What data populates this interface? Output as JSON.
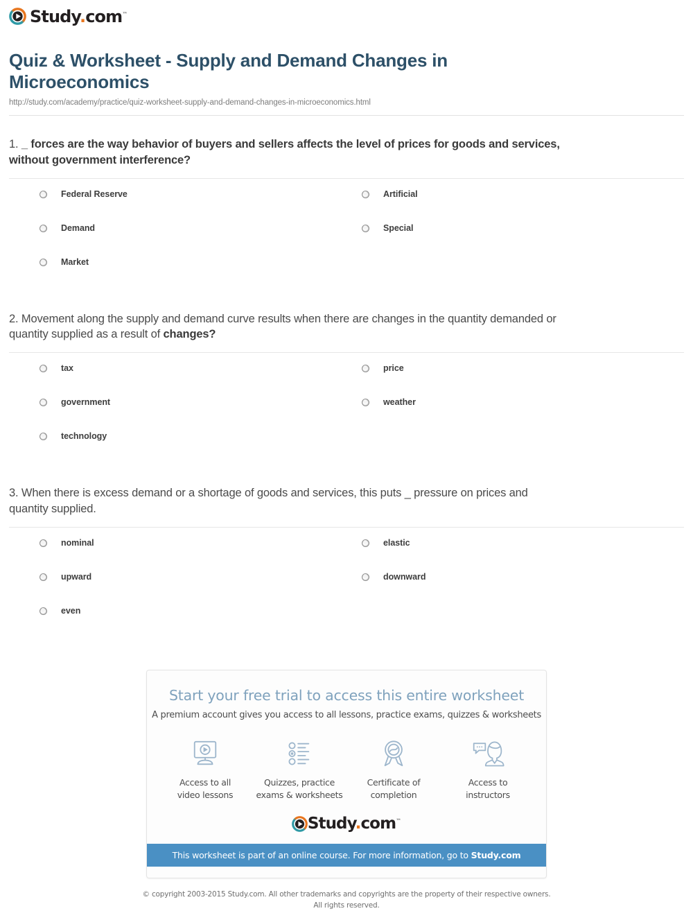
{
  "brand": {
    "name": "Study.com",
    "name_main": "Study",
    "name_dot": ".",
    "name_tld": "com",
    "trademark": "™",
    "accent_orange": "#e8761f",
    "accent_teal": "#2f9aa6",
    "logo_icon": "play-circle-icon"
  },
  "header": {
    "title": "Quiz & Worksheet - Supply and Demand Changes in Microeconomics",
    "url": "http://study.com/academy/practice/quiz-worksheet-supply-and-demand-changes-in-microeconomics.html",
    "title_color": "#2d5068"
  },
  "questions": [
    {
      "number": "1.",
      "text_plain": " _ forces are the way behavior of buyers and sellers affects the level of prices for goods and services, without government interference?",
      "text_lead": " ",
      "text_bold": "_ forces are the way behavior of buyers and sellers affects the level of prices for goods and services, without government interference?",
      "text_tail": "",
      "options": [
        {
          "label": "Federal Reserve",
          "selected": false
        },
        {
          "label": "Artificial",
          "selected": false
        },
        {
          "label": "Demand",
          "selected": false
        },
        {
          "label": "Special",
          "selected": false
        },
        {
          "label": "Market",
          "selected": false
        }
      ]
    },
    {
      "number": "2.",
      "text_plain": " Movement along the supply and demand curve results when there are changes in the quantity demanded or quantity supplied as a result of changes?",
      "text_lead": " Movement along the supply and demand curve results when there are changes in the quantity demanded or quantity supplied as a result of ",
      "text_bold": "changes?",
      "text_tail": "",
      "options": [
        {
          "label": "tax",
          "selected": false
        },
        {
          "label": "price",
          "selected": false
        },
        {
          "label": "government",
          "selected": false
        },
        {
          "label": "weather",
          "selected": false
        },
        {
          "label": "technology",
          "selected": false
        }
      ]
    },
    {
      "number": "3.",
      "text_plain": " When there is excess demand or a shortage of goods and services, this puts _ pressure on prices and quantity supplied.",
      "text_lead": " When there is excess demand or a shortage of goods and services, this puts _ pressure on prices and quantity supplied.",
      "text_bold": "",
      "text_tail": "",
      "options": [
        {
          "label": "nominal",
          "selected": false
        },
        {
          "label": "elastic",
          "selected": false
        },
        {
          "label": "upward",
          "selected": false
        },
        {
          "label": "downward",
          "selected": false
        },
        {
          "label": "even",
          "selected": false
        }
      ]
    }
  ],
  "promo": {
    "title": "Start your free trial to access this entire worksheet",
    "subtitle": "A premium account gives you access to all lessons, practice exams, quizzes & worksheets",
    "title_color": "#7fa2bd",
    "features": [
      {
        "icon": "monitor-play-icon",
        "line1": "Access to all",
        "line2": "video lessons"
      },
      {
        "icon": "checklist-icon",
        "line1": "Quizzes, practice",
        "line2": "exams & worksheets"
      },
      {
        "icon": "award-ribbon-icon",
        "line1": "Certificate of",
        "line2": "completion"
      },
      {
        "icon": "instructor-chat-icon",
        "line1": "Access to",
        "line2": "instructors"
      }
    ],
    "banner_text_lead": "This worksheet is part of an online course. For more information, go to ",
    "banner_text_bold": "Study.com",
    "banner_color": "#4a90c4"
  },
  "footer": {
    "line1": "© copyright 2003-2015 Study.com. All other trademarks and copyrights are the property of their respective owners.",
    "line2": "All rights reserved."
  }
}
